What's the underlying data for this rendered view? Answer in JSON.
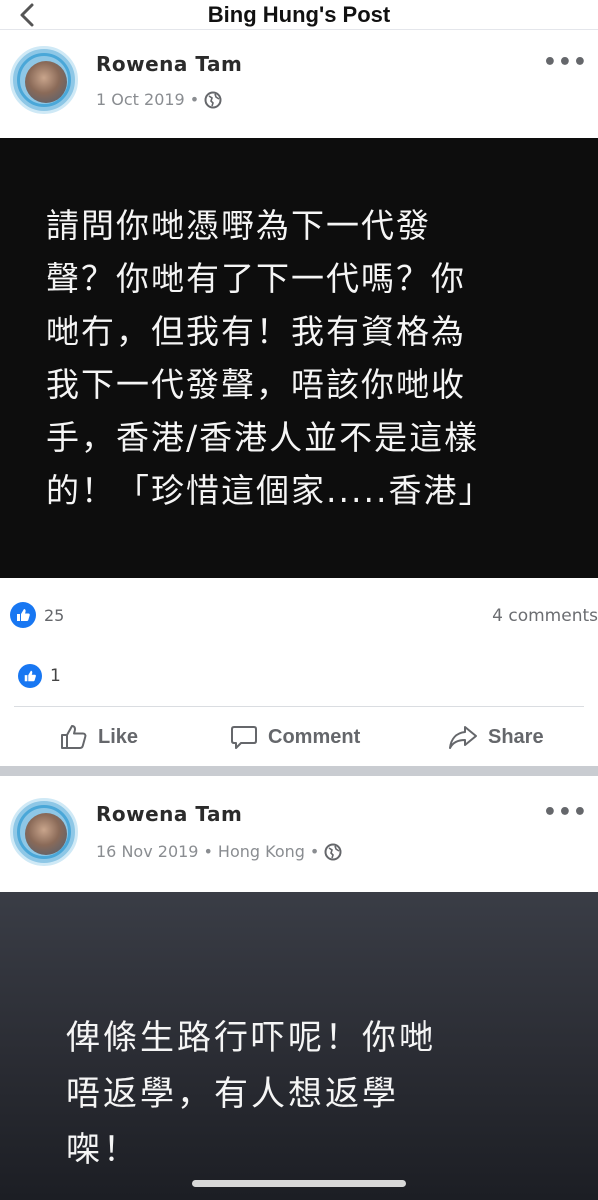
{
  "header": {
    "title": "Bing Hung's Post",
    "back_icon": "chevron-left-icon"
  },
  "posts": [
    {
      "author": "Rowena Tam",
      "date": "1 Oct 2019",
      "location": "",
      "separator": "•",
      "privacy_icon": "globe-icon",
      "more_label": "•••",
      "quote": "請問你哋憑嘢為下一代發\n聲？你哋有了下一代嗎？你\n哋冇，但我有！我有資格為\n我下一代發聲，唔該你哋收\n手，香港/香港人並不是這樣\n的！「珍惜這個家.....香港」",
      "reactions": "25",
      "comments": "4 comments"
    },
    {
      "author": "Rowena Tam",
      "date": "16 Nov 2019",
      "location": "Hong Kong",
      "separator": "•",
      "privacy_icon": "globe-icon",
      "more_label": "•••",
      "quote": "俾條生路行吓呢！你哋\n唔返學，有人想返學\n㗎！"
    }
  ],
  "share_reactions": "1",
  "actions": {
    "like": "Like",
    "comment": "Comment",
    "share": "Share"
  },
  "colors": {
    "brand_blue": "#1877f2",
    "image_bg": "#0d0d0d",
    "muted": "#65676b"
  }
}
